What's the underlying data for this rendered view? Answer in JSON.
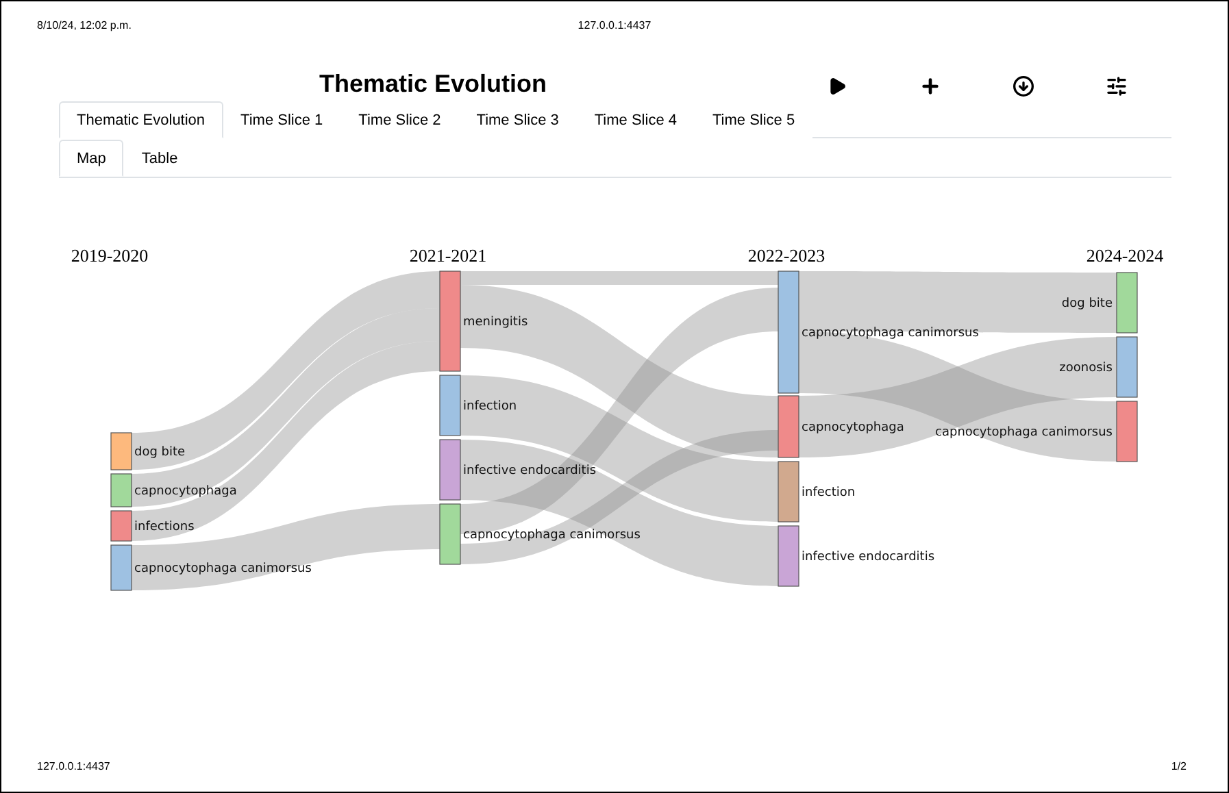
{
  "print_header": {
    "date": "8/10/24, 12:02 p.m.",
    "url": "127.0.0.1:4437"
  },
  "title": "Thematic Evolution",
  "tabs": [
    {
      "label": "Thematic Evolution",
      "selected": true
    },
    {
      "label": "Time Slice 1",
      "selected": false
    },
    {
      "label": "Time Slice 2",
      "selected": false
    },
    {
      "label": "Time Slice 3",
      "selected": false
    },
    {
      "label": "Time Slice 4",
      "selected": false
    },
    {
      "label": "Time Slice 5",
      "selected": false
    }
  ],
  "subtabs": [
    {
      "label": "Map",
      "selected": true
    },
    {
      "label": "Table",
      "selected": false
    }
  ],
  "diagram": {
    "columns": [
      {
        "label": "2019-2020",
        "nodes": [
          {
            "label": "dog bite",
            "color": "#fdb97d"
          },
          {
            "label": "capnocytophaga",
            "color": "#a1d99b"
          },
          {
            "label": "infections",
            "color": "#ef8a8a"
          },
          {
            "label": "capnocytophaga canimorsus",
            "color": "#9ec1e2"
          }
        ]
      },
      {
        "label": "2021-2021",
        "nodes": [
          {
            "label": "meningitis",
            "color": "#ef8a8a"
          },
          {
            "label": "infection",
            "color": "#9ec1e2"
          },
          {
            "label": "infective endocarditis",
            "color": "#c9a5d6"
          },
          {
            "label": "capnocytophaga canimorsus",
            "color": "#a1d99b"
          }
        ]
      },
      {
        "label": "2022-2023",
        "nodes": [
          {
            "label": "capnocytophaga canimorsus",
            "color": "#9ec1e2"
          },
          {
            "label": "capnocytophaga",
            "color": "#ef8a8a"
          },
          {
            "label": "infection",
            "color": "#d1a98e"
          },
          {
            "label": "infective endocarditis",
            "color": "#c9a5d6"
          }
        ]
      },
      {
        "label": "2024-2024",
        "nodes": [
          {
            "label": "dog bite",
            "color": "#a1d99b"
          },
          {
            "label": "zoonosis",
            "color": "#9ec1e2"
          },
          {
            "label": "capnocytophaga canimorsus",
            "color": "#ef8a8a"
          }
        ]
      }
    ]
  },
  "footer": {
    "url": "127.0.0.1:4437",
    "page": "1/2"
  }
}
